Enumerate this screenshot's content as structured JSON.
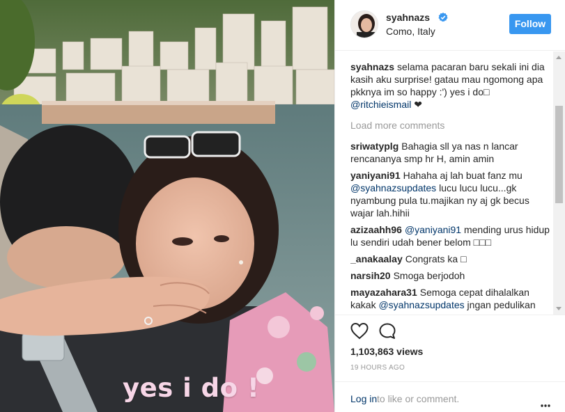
{
  "media": {
    "video_caption": "yes i do !"
  },
  "header": {
    "username": "syahnazs",
    "location": "Como, Italy",
    "follow_label": "Follow",
    "verified_icon": "verified-badge-icon",
    "accent_color": "#3897f0"
  },
  "caption": {
    "username": "syahnazs",
    "text": "selama pacaran baru sekali ini dia kasih aku surprise! gatau mau ngomong apa pkknya im so happy :') yes i do□",
    "mention": "@ritchieismail",
    "trailing": " ❤"
  },
  "load_more": "Load more comments",
  "comments": [
    {
      "user": "sriwatyplg",
      "pre": "Bahagia sll ya nas n lancar rencananya smp hr H, amin amin",
      "mention": "",
      "post": ""
    },
    {
      "user": "yaniyani91",
      "pre": "Hahaha aj lah buat fanz mu ",
      "mention": "@syahnazsupdates",
      "post": " lucu lucu lucu...gk nyambung pula tu.majikan ny aj gk becus wajar lah.hihii"
    },
    {
      "user": "azizaahh96",
      "pre": "",
      "mention": "@yaniyani91",
      "post": " mending urus hidup lu sendiri udah bener belom □□□"
    },
    {
      "user": "_anakaalay",
      "pre": "Congrats ka □",
      "mention": "",
      "post": ""
    },
    {
      "user": "narsih20",
      "pre": "Smoga berjodoh",
      "mention": "",
      "post": ""
    },
    {
      "user": "mayazahara31",
      "pre": "Semoga cepat dihalalkan kakak ",
      "mention": "@syahnazsupdates",
      "post": " jngan pedulikan kata\" orang. Hidup\" kita"
    }
  ],
  "actions": {
    "like_icon": "heart-icon",
    "comment_icon": "speech-bubble-icon",
    "views": "1,103,863 views",
    "timestamp": "19 HOURS AGO"
  },
  "add_comment": {
    "login_label": "Log in",
    "rest_label": "to like or comment.",
    "more_icon": "ellipsis-icon"
  }
}
